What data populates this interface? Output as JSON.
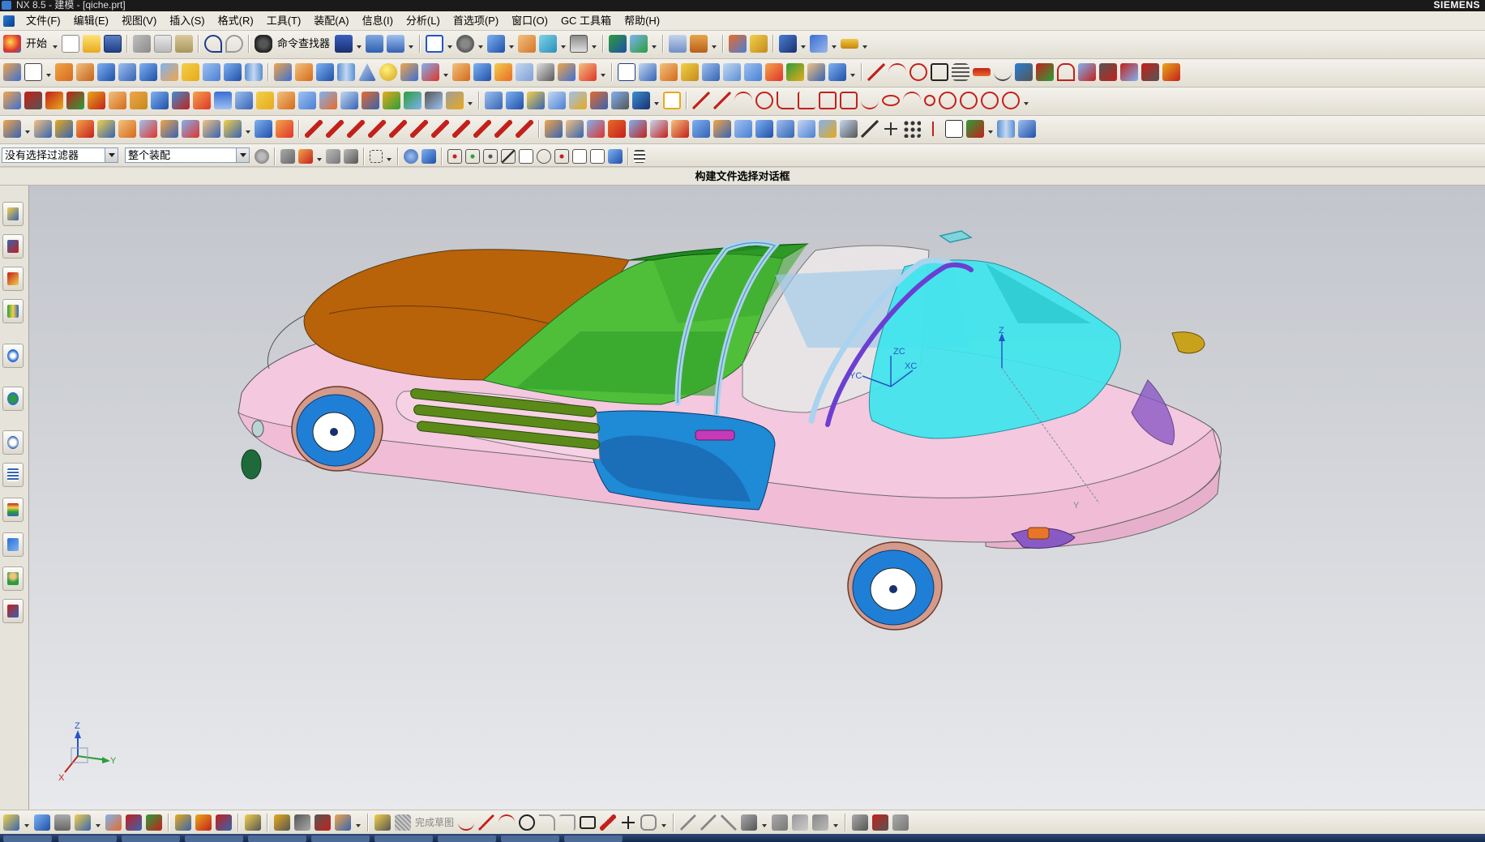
{
  "window": {
    "title": "NX 8.5 - 建模 - [qiche.prt]",
    "brand": "SIEMENS"
  },
  "menu": {
    "items": [
      "文件(F)",
      "编辑(E)",
      "视图(V)",
      "插入(S)",
      "格式(R)",
      "工具(T)",
      "装配(A)",
      "信息(I)",
      "分析(L)",
      "首选项(P)",
      "窗口(O)",
      "GC 工具箱",
      "帮助(H)"
    ]
  },
  "toolbar": {
    "start_label": "开始",
    "command_finder_label": "命令查找器"
  },
  "filter": {
    "selection_filter": "没有选择过滤器",
    "scope": "整个装配"
  },
  "cue": {
    "text": "构建文件选择对话框"
  },
  "bottom_toolbar": {
    "finish_sketch_label": "完成草图"
  },
  "viewport": {
    "background_top": "#c2c5cb",
    "background_bottom": "#e8e9ec",
    "triad_labels": {
      "z": "Z",
      "y": "Y",
      "x": "X"
    },
    "wcs_labels": {
      "zc": "ZC",
      "xc": "XC",
      "yc": "YC"
    },
    "datum_labels": {
      "z": "Z",
      "y": "Y"
    },
    "model_colors": {
      "body": "#f4c8de",
      "hood": "#b8620a",
      "interior_green": "#4fbf3a",
      "windshield_green": "#1f8a1f",
      "cabin_cyan": "#3fe6ee",
      "door": "#1f8ad6",
      "grille": "#5b8a18",
      "wheel": "#1f7fd6",
      "roll_bar": "#a9d3ef",
      "roll_bar_purple": "#6b3fd1",
      "light_yellow": "#c9a21c"
    }
  }
}
